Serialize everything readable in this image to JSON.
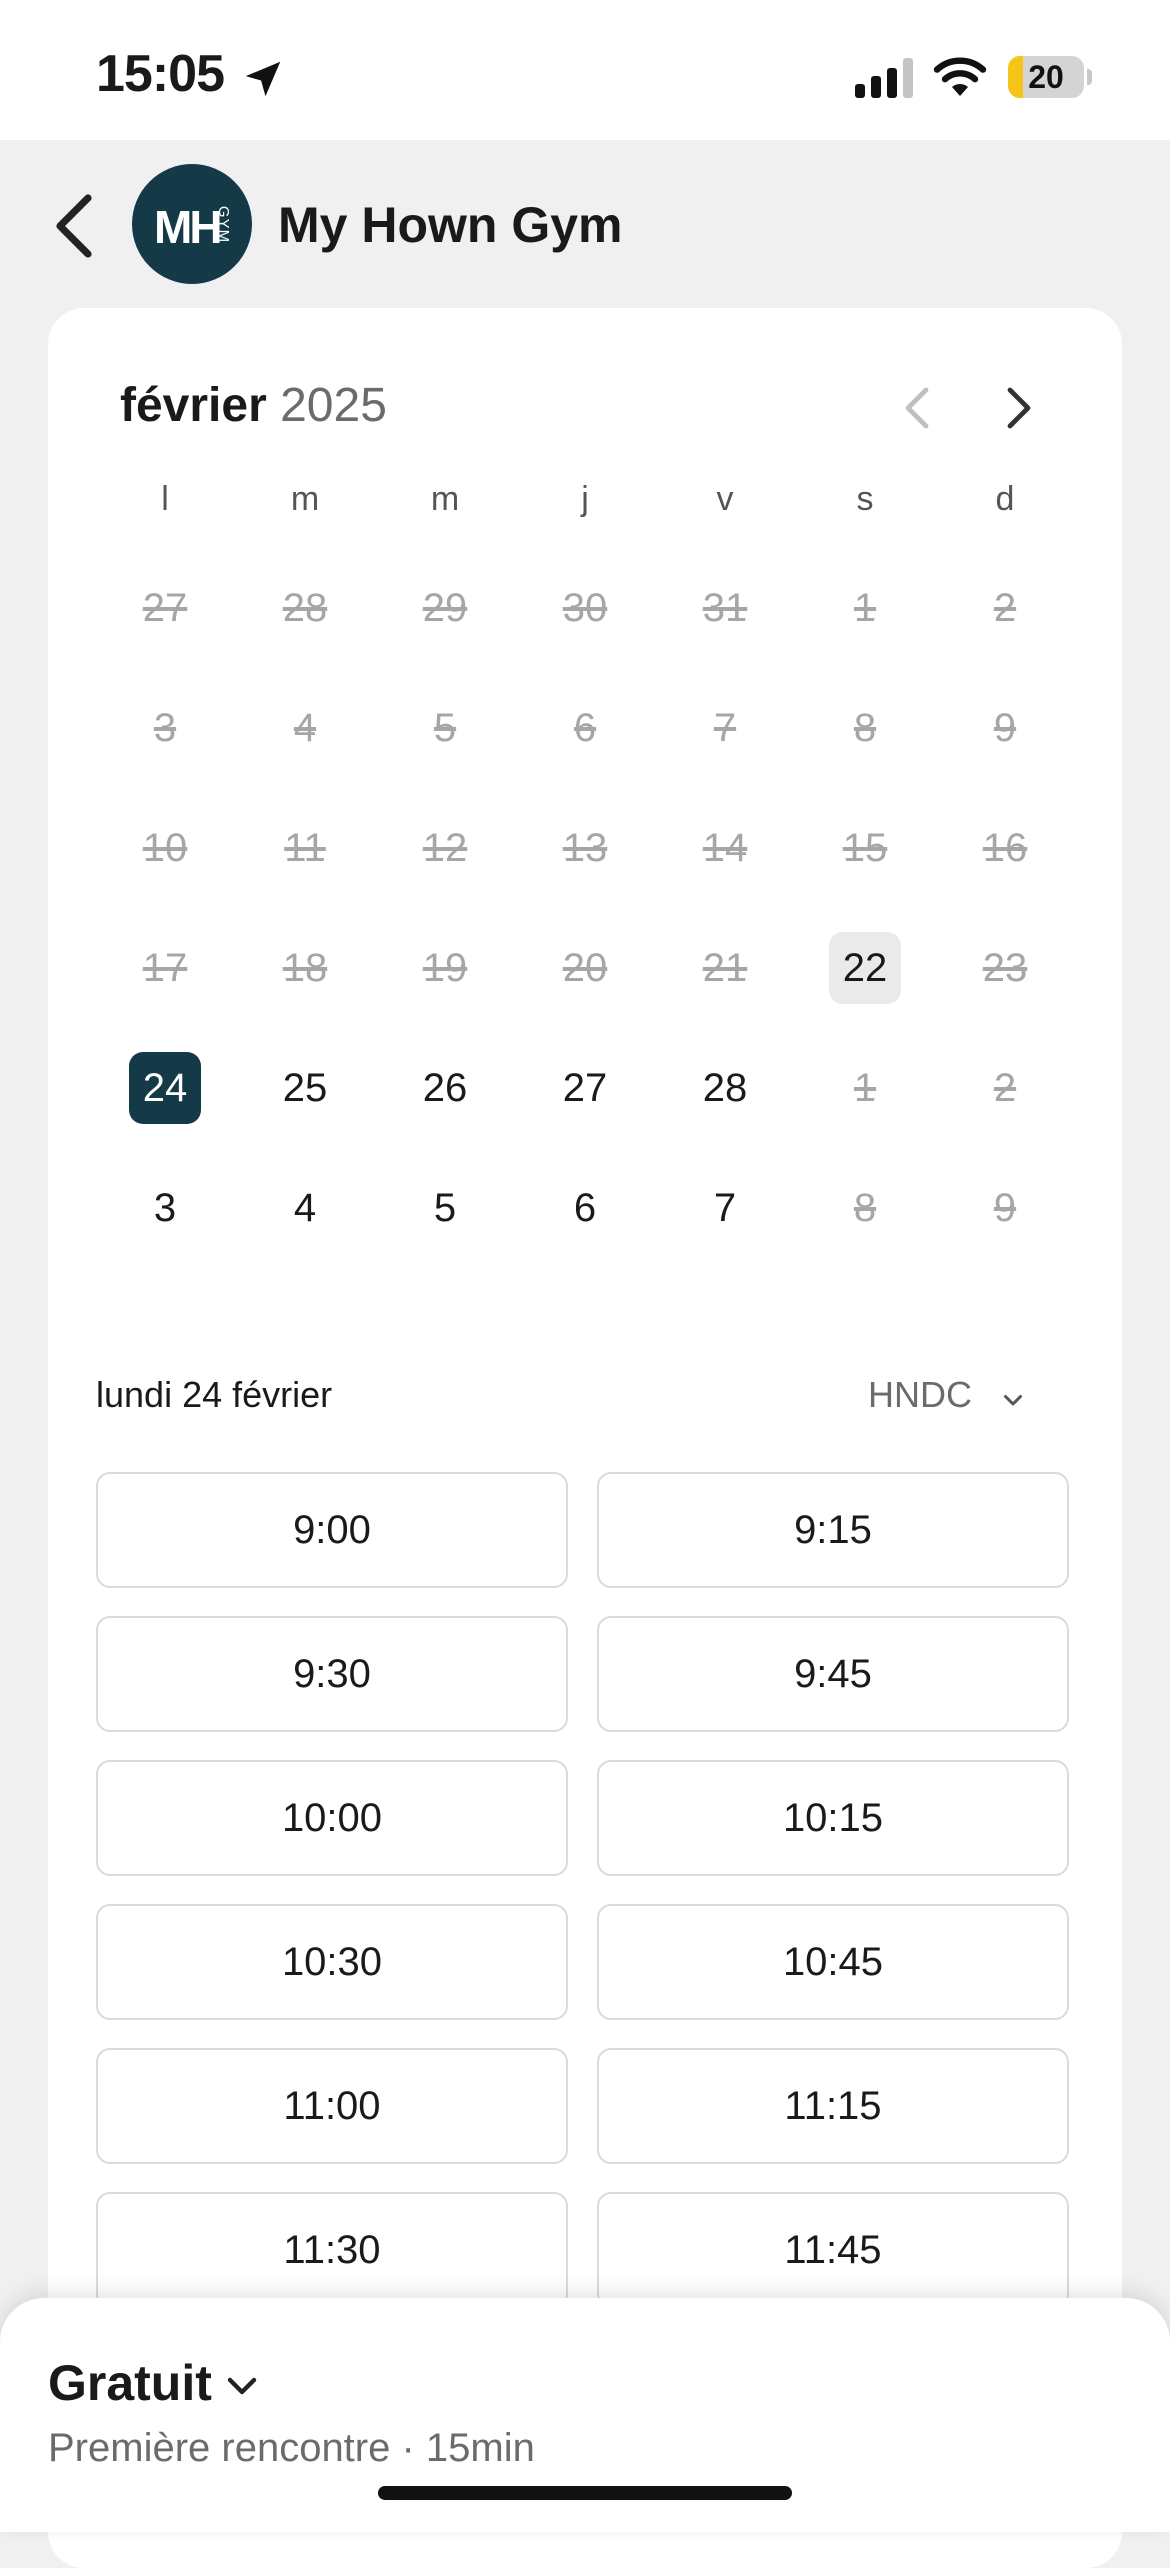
{
  "status_bar": {
    "time": "15:05",
    "battery_level": "20",
    "battery_fraction": 0.2,
    "icons": [
      "location-arrow-icon",
      "cellular-signal-icon",
      "wifi-icon",
      "battery-icon"
    ],
    "battery_color": "#f5c518"
  },
  "header": {
    "back_icon": "chevron-left-icon",
    "avatar_monogram": "MH",
    "avatar_sub": "GYM",
    "gym_name": "My Hown Gym",
    "avatar_color": "#143a47"
  },
  "calendar": {
    "month": "février",
    "year": "2025",
    "prev_icon": "chevron-left-icon",
    "next_icon": "chevron-right-icon",
    "weekdays": [
      "l",
      "m",
      "m",
      "j",
      "v",
      "s",
      "d"
    ],
    "weeks": [
      [
        {
          "d": "27",
          "s": "past"
        },
        {
          "d": "28",
          "s": "past"
        },
        {
          "d": "29",
          "s": "past"
        },
        {
          "d": "30",
          "s": "past"
        },
        {
          "d": "31",
          "s": "past"
        },
        {
          "d": "1",
          "s": "past"
        },
        {
          "d": "2",
          "s": "past"
        }
      ],
      [
        {
          "d": "3",
          "s": "past"
        },
        {
          "d": "4",
          "s": "past"
        },
        {
          "d": "5",
          "s": "past"
        },
        {
          "d": "6",
          "s": "past"
        },
        {
          "d": "7",
          "s": "past"
        },
        {
          "d": "8",
          "s": "past"
        },
        {
          "d": "9",
          "s": "past"
        }
      ],
      [
        {
          "d": "10",
          "s": "past"
        },
        {
          "d": "11",
          "s": "past"
        },
        {
          "d": "12",
          "s": "past"
        },
        {
          "d": "13",
          "s": "past"
        },
        {
          "d": "14",
          "s": "past"
        },
        {
          "d": "15",
          "s": "past"
        },
        {
          "d": "16",
          "s": "past"
        }
      ],
      [
        {
          "d": "17",
          "s": "past"
        },
        {
          "d": "18",
          "s": "past"
        },
        {
          "d": "19",
          "s": "past"
        },
        {
          "d": "20",
          "s": "past"
        },
        {
          "d": "21",
          "s": "past"
        },
        {
          "d": "22",
          "s": "today"
        },
        {
          "d": "23",
          "s": "past"
        }
      ],
      [
        {
          "d": "24",
          "s": "selected"
        },
        {
          "d": "25",
          "s": "available"
        },
        {
          "d": "26",
          "s": "available"
        },
        {
          "d": "27",
          "s": "available"
        },
        {
          "d": "28",
          "s": "available"
        },
        {
          "d": "1",
          "s": "unavailable"
        },
        {
          "d": "2",
          "s": "unavailable"
        }
      ],
      [
        {
          "d": "3",
          "s": "available"
        },
        {
          "d": "4",
          "s": "available"
        },
        {
          "d": "5",
          "s": "available"
        },
        {
          "d": "6",
          "s": "available"
        },
        {
          "d": "7",
          "s": "available"
        },
        {
          "d": "8",
          "s": "unavailable"
        },
        {
          "d": "9",
          "s": "unavailable"
        }
      ]
    ],
    "selected_color": "#143a47"
  },
  "schedule": {
    "selected_date_label": "lundi 24 février",
    "timezone": "HNDC",
    "timezone_icon": "chevron-down-icon",
    "slots": [
      "9:00",
      "9:15",
      "9:30",
      "9:45",
      "10:00",
      "10:15",
      "10:30",
      "10:45",
      "11:00",
      "11:15",
      "11:30",
      "11:45"
    ]
  },
  "booking": {
    "price": "Gratuit",
    "price_icon": "chevron-down-icon",
    "service": "Première rencontre · 15min"
  }
}
